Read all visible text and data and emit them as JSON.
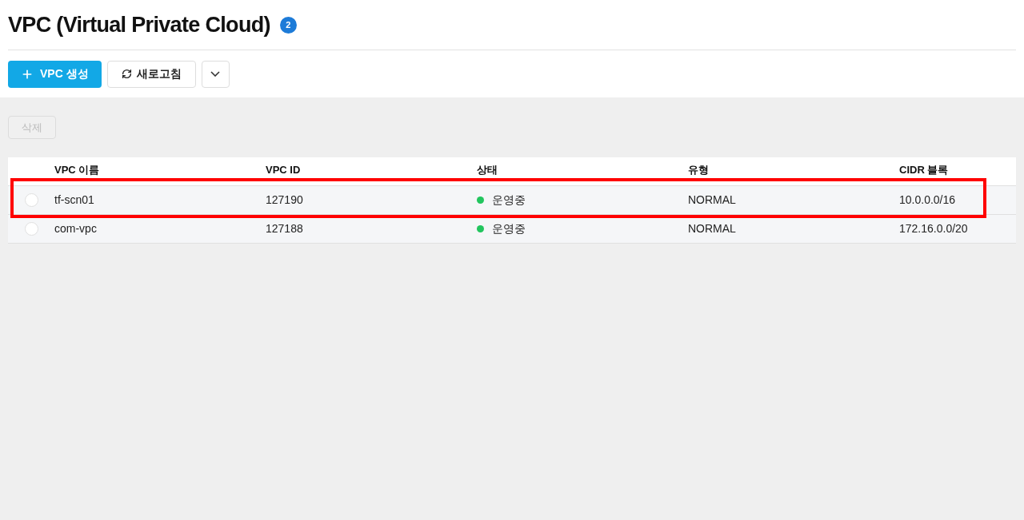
{
  "header": {
    "title": "VPC (Virtual Private Cloud)",
    "count": "2"
  },
  "toolbar": {
    "create_button": "VPC 생성",
    "refresh_button": "새로고침"
  },
  "delete_button": {
    "label": "삭제",
    "disabled": true
  },
  "table": {
    "columns": [
      "VPC 이름",
      "VPC ID",
      "상태",
      "유형",
      "CIDR 블록"
    ],
    "rows": [
      {
        "selected": false,
        "highlighted": true,
        "cells": [
          "tf-scn01",
          "127190",
          "운영중",
          "NORMAL",
          "10.0.0.0/16"
        ],
        "color": "#22c55e"
      },
      {
        "selected": false,
        "highlighted": false,
        "cells": [
          "com-vpc",
          "127188",
          "운영중",
          "NORMAL",
          "172.16.0.0/20"
        ],
        "color": "#22c55e"
      }
    ]
  }
}
